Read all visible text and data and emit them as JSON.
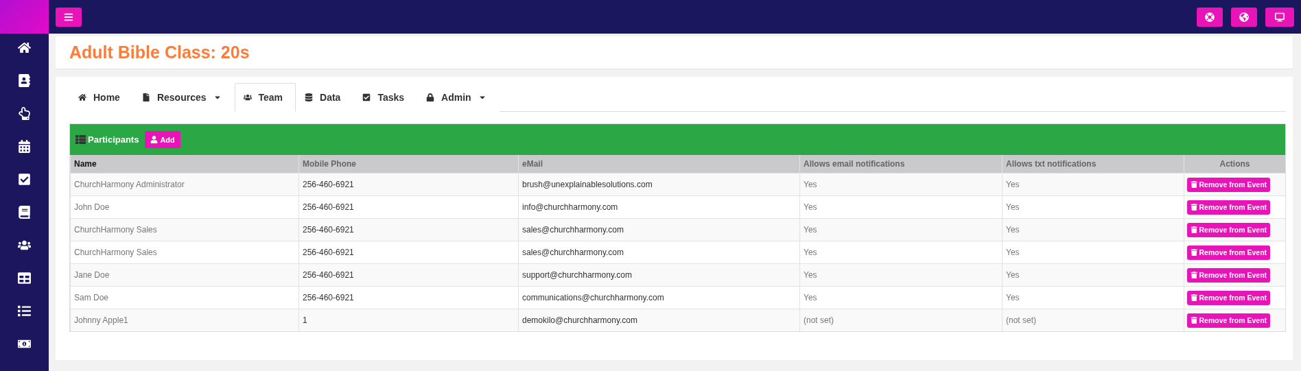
{
  "page": {
    "title": "Adult Bible Class: 20s"
  },
  "tabs": [
    {
      "label": "Home",
      "selected": false,
      "dropdown": false
    },
    {
      "label": "Resources",
      "selected": false,
      "dropdown": true
    },
    {
      "label": "Team",
      "selected": true,
      "dropdown": false
    },
    {
      "label": "Data",
      "selected": false,
      "dropdown": false
    },
    {
      "label": "Tasks",
      "selected": false,
      "dropdown": false
    },
    {
      "label": "Admin",
      "selected": false,
      "dropdown": true
    }
  ],
  "participants": {
    "title": "Participants",
    "add_button": "Add",
    "columns": [
      "Name",
      "Mobile Phone",
      "eMail",
      "Allows email notifications",
      "Allows txt notifications",
      "Actions"
    ],
    "rows": [
      {
        "name": "ChurchHarmony Administrator",
        "phone": "256-460-6921",
        "email": "brush@unexplainablesolutions.com",
        "email_notifications": "Yes",
        "txt_notifications": "Yes",
        "action": "Remove from Event"
      },
      {
        "name": "John Doe",
        "phone": "256-460-6921",
        "email": "info@churchharmony.com",
        "email_notifications": "Yes",
        "txt_notifications": "Yes",
        "action": "Remove from Event"
      },
      {
        "name": "ChurchHarmony Sales",
        "phone": "256-460-6921",
        "email": "sales@churchharmony.com",
        "email_notifications": "Yes",
        "txt_notifications": "Yes",
        "action": "Remove from Event"
      },
      {
        "name": "ChurchHarmony Sales",
        "phone": "256-460-6921",
        "email": "sales@churchharmony.com",
        "email_notifications": "Yes",
        "txt_notifications": "Yes",
        "action": "Remove from Event"
      },
      {
        "name": "Jane Doe",
        "phone": "256-460-6921",
        "email": "support@churchharmony.com",
        "email_notifications": "Yes",
        "txt_notifications": "Yes",
        "action": "Remove from Event"
      },
      {
        "name": "Sam Doe",
        "phone": "256-460-6921",
        "email": "communications@churchharmony.com",
        "email_notifications": "Yes",
        "txt_notifications": "Yes",
        "action": "Remove from Event"
      },
      {
        "name": "Johnny Apple1",
        "phone": "1",
        "email": "demokilo@churchharmony.com",
        "email_notifications": "(not set)",
        "txt_notifications": "(not set)",
        "action": "Remove from Event"
      }
    ]
  }
}
